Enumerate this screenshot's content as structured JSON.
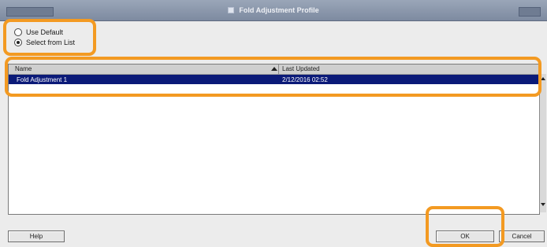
{
  "window": {
    "title": "Fold Adjustment Profile"
  },
  "options": {
    "use_default": "Use Default",
    "select_from_list": "Select from List"
  },
  "table": {
    "columns": [
      "Name",
      "Last Updated"
    ],
    "rows": [
      {
        "name": "Fold Adjustment 1",
        "updated": "2/12/2016 02:52"
      }
    ]
  },
  "buttons": {
    "help": "Help",
    "ok": "OK",
    "cancel": "Cancel"
  },
  "colors": {
    "selection": "#0b1a78",
    "callout": "#f39a22",
    "titlebar": "#8a97ab"
  }
}
